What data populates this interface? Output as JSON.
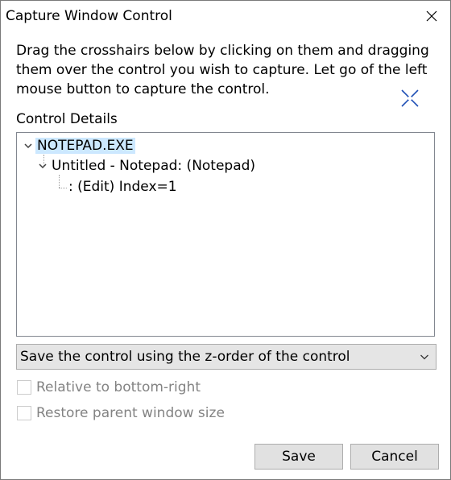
{
  "window": {
    "title": "Capture Window Control",
    "close_icon": "close-icon"
  },
  "instructions": "Drag the crosshairs below by clicking on them and dragging them over the control you wish to capture. Let go of the left mouse button to capture the control.",
  "crosshair_icon": "crosshair-icon",
  "control_details": {
    "label": "Control Details",
    "tree": [
      {
        "label": "NOTEPAD.EXE",
        "selected": true,
        "expanded": true
      },
      {
        "label": "Untitled - Notepad: (Notepad)",
        "selected": false,
        "expanded": true
      },
      {
        "label": ": (Edit) Index=1",
        "selected": false,
        "expanded": false
      }
    ]
  },
  "save_mode": {
    "selected": "Save the control using the z-order of the control",
    "arrow_icon": "chevron-down-icon"
  },
  "options": [
    {
      "label": "Relative to bottom-right",
      "checked": false,
      "enabled": false
    },
    {
      "label": "Restore parent window size",
      "checked": false,
      "enabled": false
    }
  ],
  "buttons": {
    "save": "Save",
    "cancel": "Cancel"
  },
  "colors": {
    "selection": "#cce8ff",
    "crosshair": "#1f4fb5",
    "disabled_text": "#838383"
  }
}
